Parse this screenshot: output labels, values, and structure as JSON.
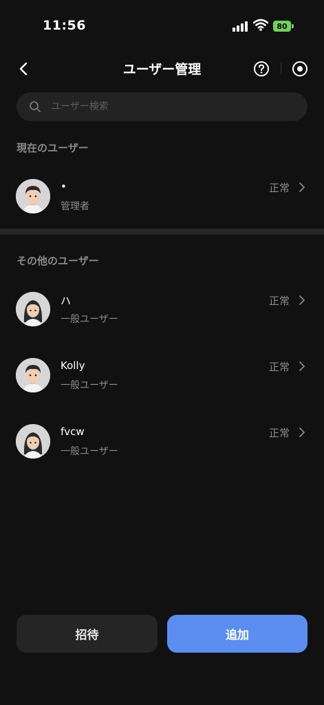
{
  "status_bar": {
    "time": "11:56",
    "battery": "80"
  },
  "header": {
    "title": "ユーザー管理"
  },
  "search": {
    "placeholder": "ユーザー検索"
  },
  "current_section": {
    "title": "現在のユーザー",
    "user": {
      "name": "•",
      "role": "管理者",
      "status": "正常",
      "avatar": "male-avatar"
    }
  },
  "other_section": {
    "title": "その他のユーザー",
    "users": [
      {
        "name": "ハ",
        "role": "一般ユーザー",
        "status": "正常",
        "avatar": "female-avatar"
      },
      {
        "name": "Kolly",
        "role": "一般ユーザー",
        "status": "正常",
        "avatar": "male-avatar"
      },
      {
        "name": "fvcw",
        "role": "一般ユーザー",
        "status": "正常",
        "avatar": "female-avatar"
      }
    ]
  },
  "actions": {
    "invite_label": "招待",
    "add_label": "追加"
  },
  "colors": {
    "background": "#111111",
    "accent": "#5b8ef0",
    "battery": "#6fd35b"
  }
}
